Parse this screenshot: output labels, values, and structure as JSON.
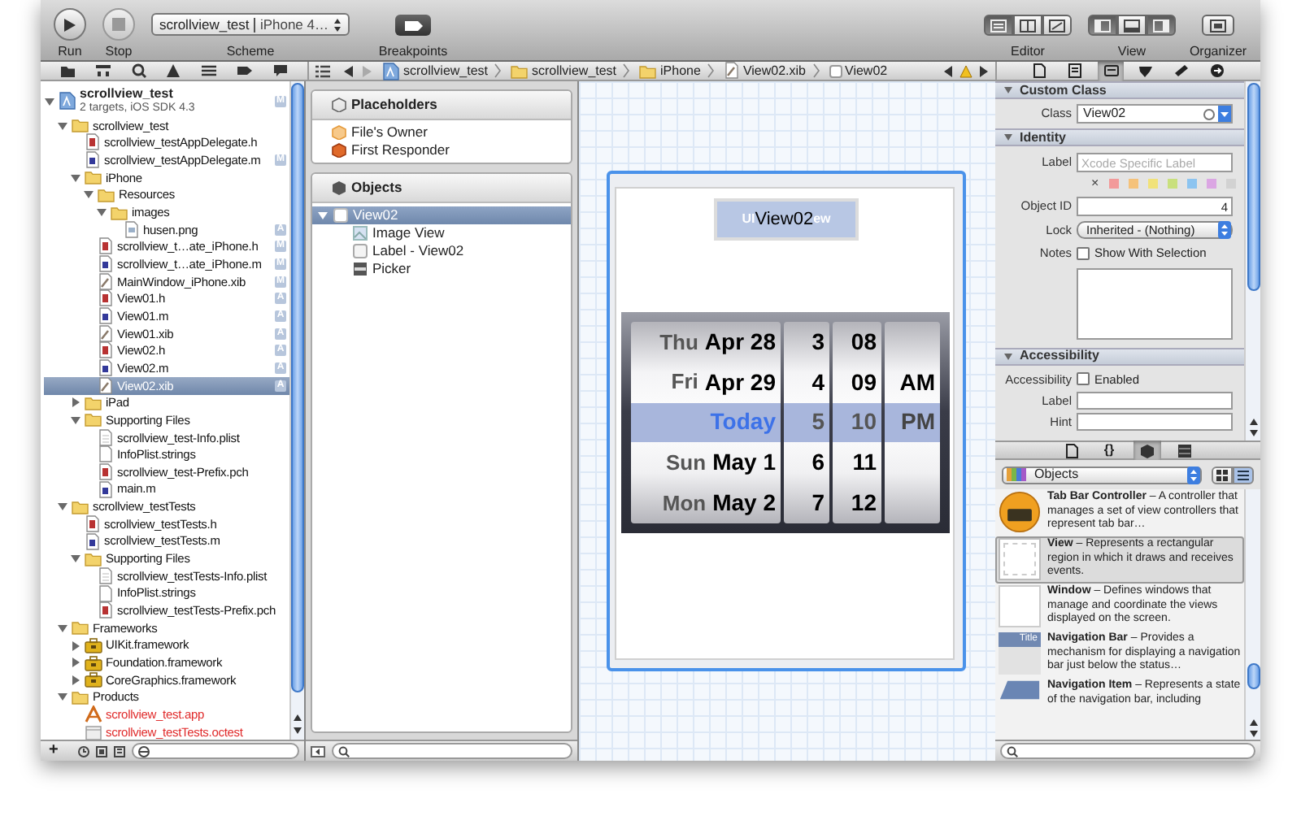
{
  "toolbar": {
    "run": "Run",
    "stop": "Stop",
    "scheme": {
      "target": "scrollview_test",
      "device": "iPhone 4…",
      "label": "Scheme"
    },
    "breakpoints": "Breakpoints",
    "editor": {
      "label": "Editor",
      "modes": [
        {
          "selected": true
        },
        {
          "selected": false
        },
        {
          "selected": false
        }
      ]
    },
    "view": {
      "label": "View",
      "panes": [
        {
          "selected": true
        },
        {
          "selected": false
        },
        {
          "selected": true
        }
      ]
    },
    "organizer": "Organizer"
  },
  "jump_bar": {
    "crumbs": [
      {
        "label": "scrollview_test",
        "kind": "project"
      },
      {
        "label": "scrollview_test",
        "kind": "folder"
      },
      {
        "label": "iPhone",
        "kind": "folder"
      },
      {
        "label": "View02.xib",
        "kind": "xib"
      },
      {
        "label": "View02",
        "kind": "view"
      }
    ]
  },
  "navigator": {
    "tree": [
      {
        "label": "scrollview_test",
        "subtitle": "2 targets, iOS SDK 4.3",
        "kind": "project",
        "badge": "M",
        "expanded": true,
        "selected": false,
        "children": [
          {
            "label": "scrollview_test",
            "kind": "folder",
            "expanded": true,
            "selected": false,
            "children": [
              {
                "label": "scrollview_testAppDelegate.h",
                "kind": "h",
                "selected": false
              },
              {
                "label": "scrollview_testAppDelegate.m",
                "kind": "m",
                "badge": "M",
                "selected": false
              },
              {
                "label": "iPhone",
                "kind": "folder",
                "expanded": true,
                "selected": false,
                "children": [
                  {
                    "label": "Resources",
                    "kind": "folder",
                    "expanded": true,
                    "selected": false,
                    "children": [
                      {
                        "label": "images",
                        "kind": "folder",
                        "expanded": true,
                        "selected": false,
                        "children": [
                          {
                            "label": "husen.png",
                            "kind": "png",
                            "badge": "A",
                            "selected": false
                          }
                        ]
                      }
                    ]
                  },
                  {
                    "label": "scrollview_t…ate_iPhone.h",
                    "kind": "h",
                    "badge": "M",
                    "selected": false
                  },
                  {
                    "label": "scrollview_t…ate_iPhone.m",
                    "kind": "m",
                    "badge": "M",
                    "selected": false
                  },
                  {
                    "label": "MainWindow_iPhone.xib",
                    "kind": "xib",
                    "badge": "M",
                    "selected": false
                  },
                  {
                    "label": "View01.h",
                    "kind": "h",
                    "badge": "A",
                    "selected": false
                  },
                  {
                    "label": "View01.m",
                    "kind": "m",
                    "badge": "A",
                    "selected": false
                  },
                  {
                    "label": "View01.xib",
                    "kind": "xib",
                    "badge": "A",
                    "selected": false
                  },
                  {
                    "label": "View02.h",
                    "kind": "h",
                    "badge": "A",
                    "selected": false
                  },
                  {
                    "label": "View02.m",
                    "kind": "m",
                    "badge": "A",
                    "selected": false
                  },
                  {
                    "label": "View02.xib",
                    "kind": "xib",
                    "badge": "A",
                    "selected": true
                  }
                ]
              },
              {
                "label": "iPad",
                "kind": "folder",
                "expanded": false,
                "selected": false
              },
              {
                "label": "Supporting Files",
                "kind": "folder",
                "expanded": true,
                "selected": false,
                "children": [
                  {
                    "label": "scrollview_test-Info.plist",
                    "kind": "plist",
                    "selected": false
                  },
                  {
                    "label": "InfoPlist.strings",
                    "kind": "strings",
                    "selected": false
                  },
                  {
                    "label": "scrollview_test-Prefix.pch",
                    "kind": "h",
                    "selected": false
                  },
                  {
                    "label": "main.m",
                    "kind": "m",
                    "selected": false
                  }
                ]
              }
            ]
          },
          {
            "label": "scrollview_testTests",
            "kind": "folder",
            "expanded": true,
            "selected": false,
            "children": [
              {
                "label": "scrollview_testTests.h",
                "kind": "h",
                "selected": false
              },
              {
                "label": "scrollview_testTests.m",
                "kind": "m",
                "selected": false
              },
              {
                "label": "Supporting Files",
                "kind": "folder",
                "expanded": true,
                "selected": false,
                "children": [
                  {
                    "label": "scrollview_testTests-Info.plist",
                    "kind": "plist",
                    "selected": false
                  },
                  {
                    "label": "InfoPlist.strings",
                    "kind": "strings",
                    "selected": false
                  },
                  {
                    "label": "scrollview_testTests-Prefix.pch",
                    "kind": "h",
                    "selected": false
                  }
                ]
              }
            ]
          },
          {
            "label": "Frameworks",
            "kind": "folder",
            "expanded": true,
            "selected": false,
            "children": [
              {
                "label": "UIKit.framework",
                "kind": "framework",
                "expanded": false,
                "selected": false
              },
              {
                "label": "Foundation.framework",
                "kind": "framework",
                "expanded": false,
                "selected": false
              },
              {
                "label": "CoreGraphics.framework",
                "kind": "framework",
                "expanded": false,
                "selected": false
              }
            ]
          },
          {
            "label": "Products",
            "kind": "folder",
            "expanded": true,
            "selected": false,
            "children": [
              {
                "label": "scrollview_test.app",
                "kind": "app",
                "missing": true,
                "selected": false
              },
              {
                "label": "scrollview_testTests.octest",
                "kind": "octest",
                "missing": true,
                "selected": false
              }
            ]
          }
        ]
      }
    ]
  },
  "outline": {
    "sections": [
      {
        "title": "Placeholders",
        "items": [
          {
            "label": "File's Owner",
            "kind": "owner",
            "selected": false
          },
          {
            "label": "First Responder",
            "kind": "responder",
            "selected": false
          }
        ]
      },
      {
        "title": "Objects",
        "items": [
          {
            "label": "View02",
            "kind": "view",
            "expanded": true,
            "selected": true,
            "children": [
              {
                "label": "Image View",
                "kind": "image",
                "selected": false
              },
              {
                "label": "Label - View02",
                "kind": "label",
                "selected": false
              },
              {
                "label": "Picker",
                "kind": "picker",
                "selected": false
              }
            ]
          }
        ]
      }
    ]
  },
  "canvas": {
    "image_caption_start": "UI",
    "label": "View02",
    "image_caption_end": "ew",
    "picker": {
      "rows": [
        {
          "day": "Thu",
          "date": "Apr 28",
          "hour": "3",
          "minute": "08",
          "period": "",
          "selected": false
        },
        {
          "day": "Fri",
          "date": "Apr 29",
          "hour": "4",
          "minute": "09",
          "period": "AM",
          "selected": false
        },
        {
          "day": "",
          "date": "Today",
          "hour": "5",
          "minute": "10",
          "period": "PM",
          "selected": true
        },
        {
          "day": "Sun",
          "date": "May 1",
          "hour": "6",
          "minute": "11",
          "period": "",
          "selected": false
        },
        {
          "day": "Mon",
          "date": "May 2",
          "hour": "7",
          "minute": "12",
          "period": "",
          "selected": false
        }
      ]
    }
  },
  "inspector": {
    "tabs": [
      {
        "selected": false
      },
      {
        "selected": false
      },
      {
        "selected": true
      },
      {
        "selected": false
      },
      {
        "selected": false
      },
      {
        "selected": false
      }
    ],
    "custom_class": {
      "title": "Custom Class",
      "class_label": "Class",
      "class_value": "View02"
    },
    "identity": {
      "title": "Identity",
      "label_label": "Label",
      "label_placeholder": "Xcode Specific Label",
      "clear_mark": "×",
      "swatches": [
        {
          "color": "#f29a9a"
        },
        {
          "color": "#f5c27a"
        },
        {
          "color": "#f1e27a"
        },
        {
          "color": "#c9e07d"
        },
        {
          "color": "#8cc4f0"
        },
        {
          "color": "#dba6e3"
        },
        {
          "color": "#d2d2d2"
        }
      ],
      "object_id_label": "Object ID",
      "object_id": "4",
      "lock_label": "Lock",
      "lock_value": "Inherited - (Nothing)",
      "notes_label": "Notes",
      "notes_checked": false,
      "notes_option": "Show With Selection"
    },
    "accessibility": {
      "title": "Accessibility",
      "label": "Accessibility",
      "checked": false,
      "option": "Enabled",
      "fields": [
        "Label",
        "Hint"
      ]
    }
  },
  "library": {
    "tabs": [
      {
        "kind": "file",
        "selected": false
      },
      {
        "kind": "glyph",
        "text": "{}",
        "selected": false
      },
      {
        "kind": "object",
        "selected": true
      },
      {
        "kind": "media",
        "selected": false
      }
    ],
    "popup": "Objects",
    "modes": [
      {
        "kind": "grid",
        "selected": false
      },
      {
        "kind": "list",
        "selected": true
      }
    ],
    "items": [
      {
        "kind": "tabbar",
        "text": "**Tab Bar Controller** – A controller that manages a set of view controllers that represent tab bar…",
        "selected": false
      },
      {
        "kind": "view",
        "text": "**View** – Represents a rectangular region in which it draws and receives events.",
        "selected": true
      },
      {
        "kind": "window",
        "text": "**Window** – Defines windows that manage and coordinate the views displayed on the screen.",
        "selected": false
      },
      {
        "kind": "navbar",
        "icon_text": "Title",
        "text": "**Navigation Bar** – Provides a mechanism for displaying a navigation bar just below the status…",
        "selected": false
      },
      {
        "kind": "navitem",
        "text": "**Navigation Item** – Represents a state of the navigation bar, including",
        "selected": false
      }
    ]
  },
  "bottom_bar": {
    "add": "+"
  }
}
